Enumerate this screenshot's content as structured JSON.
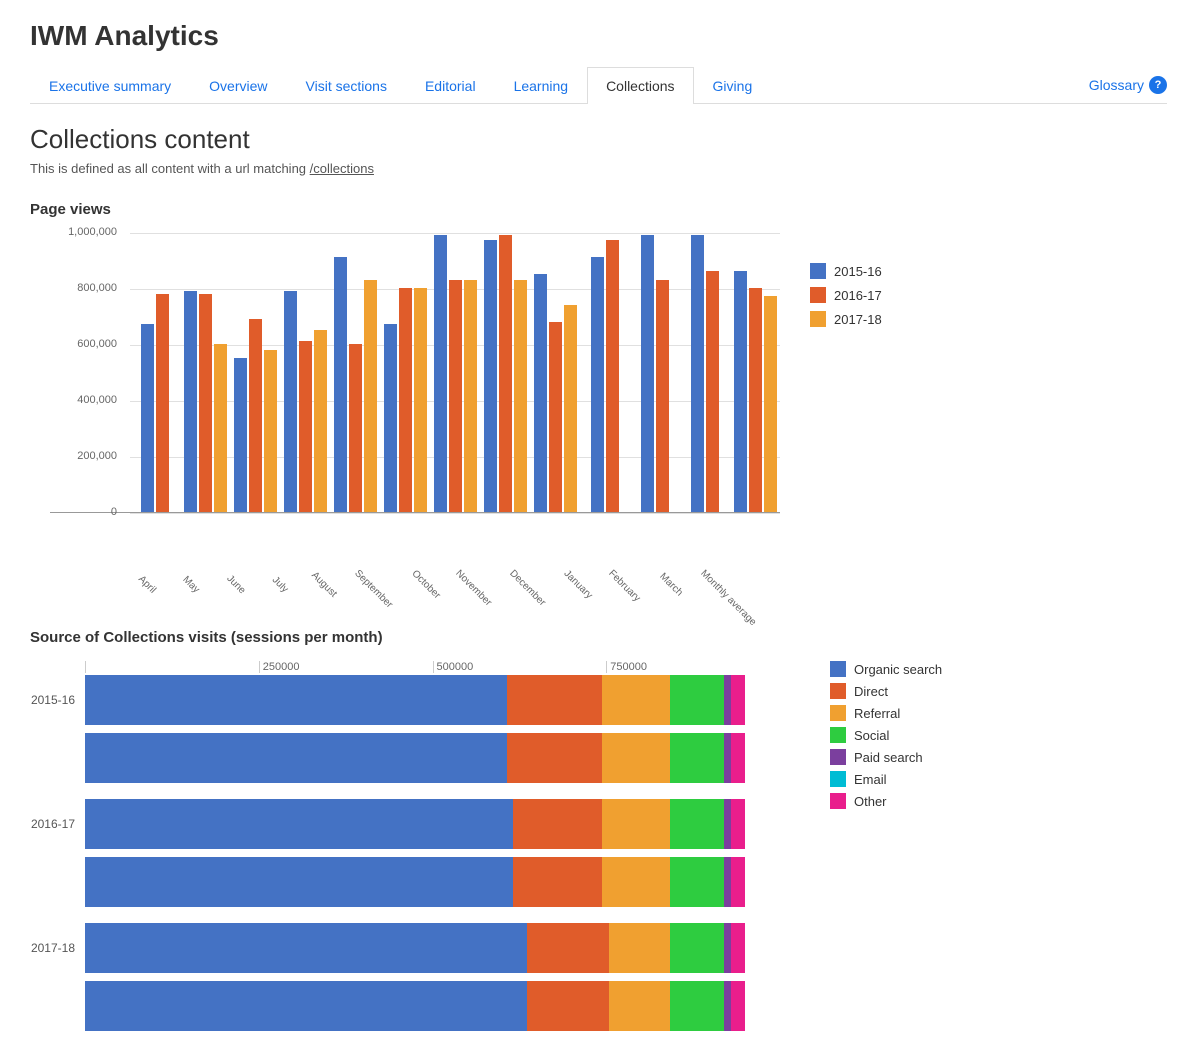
{
  "app": {
    "title": "IWM Analytics"
  },
  "nav": {
    "tabs": [
      {
        "id": "executive-summary",
        "label": "Executive summary",
        "active": false
      },
      {
        "id": "overview",
        "label": "Overview",
        "active": false
      },
      {
        "id": "visit-sections",
        "label": "Visit sections",
        "active": false
      },
      {
        "id": "editorial",
        "label": "Editorial",
        "active": false
      },
      {
        "id": "learning",
        "label": "Learning",
        "active": false
      },
      {
        "id": "collections",
        "label": "Collections",
        "active": true
      },
      {
        "id": "giving",
        "label": "Giving",
        "active": false
      }
    ],
    "glossary_label": "Glossary",
    "help_icon": "?"
  },
  "page": {
    "heading": "Collections content",
    "subtext_prefix": "This is defined as all content with a url matching",
    "subtext_url": "/collections"
  },
  "page_views": {
    "section_title": "Page views",
    "y_labels": [
      "1000000",
      "800000",
      "600000",
      "400000",
      "200000",
      "0"
    ],
    "months": [
      "April",
      "May",
      "June",
      "July",
      "August",
      "September",
      "October",
      "November",
      "December",
      "January",
      "February",
      "March",
      "Monthly average"
    ],
    "legend": [
      {
        "label": "2015-16",
        "color": "#4472c4"
      },
      {
        "label": "2016-17",
        "color": "#e05c2a"
      },
      {
        "label": "2017-18",
        "color": "#f0a030"
      }
    ],
    "bars": [
      {
        "month": "April",
        "b1": 67,
        "b2": 78,
        "b3": 0
      },
      {
        "month": "May",
        "b1": 79,
        "b2": 78,
        "b3": 60
      },
      {
        "month": "June",
        "b1": 55,
        "b2": 69,
        "b3": 58
      },
      {
        "month": "July",
        "b1": 79,
        "b2": 61,
        "b3": 65
      },
      {
        "month": "August",
        "b1": 91,
        "b2": 60,
        "b3": 83
      },
      {
        "month": "September",
        "b1": 67,
        "b2": 80,
        "b3": 80
      },
      {
        "month": "October",
        "b1": 99,
        "b2": 83,
        "b3": 83
      },
      {
        "month": "November",
        "b1": 97,
        "b2": 99,
        "b3": 83
      },
      {
        "month": "December",
        "b1": 85,
        "b2": 68,
        "b3": 74
      },
      {
        "month": "January",
        "b1": 91,
        "b2": 97,
        "b3": 0
      },
      {
        "month": "February",
        "b1": 99,
        "b2": 83,
        "b3": 0
      },
      {
        "month": "March",
        "b1": 99,
        "b2": 86,
        "b3": 0
      },
      {
        "month": "Monthly average",
        "b1": 86,
        "b2": 80,
        "b3": 77
      }
    ]
  },
  "source": {
    "section_title": "Source of Collections visits (sessions per month)",
    "col_labels": [
      "",
      "250000",
      "500000",
      "750000"
    ],
    "rows": [
      {
        "year": "2015-16",
        "segments": [
          {
            "type": "organic",
            "pct": 62
          },
          {
            "type": "direct",
            "pct": 14
          },
          {
            "type": "referral",
            "pct": 10
          },
          {
            "type": "social",
            "pct": 8
          },
          {
            "type": "paid",
            "pct": 1
          },
          {
            "type": "other",
            "pct": 2
          }
        ]
      },
      {
        "year": "2016-17",
        "segments": [
          {
            "type": "organic",
            "pct": 63
          },
          {
            "type": "direct",
            "pct": 13
          },
          {
            "type": "referral",
            "pct": 10
          },
          {
            "type": "social",
            "pct": 8
          },
          {
            "type": "paid",
            "pct": 1
          },
          {
            "type": "other",
            "pct": 2
          }
        ]
      },
      {
        "year": "2017-18",
        "segments": [
          {
            "type": "organic",
            "pct": 65
          },
          {
            "type": "direct",
            "pct": 12
          },
          {
            "type": "referral",
            "pct": 9
          },
          {
            "type": "social",
            "pct": 8
          },
          {
            "type": "paid",
            "pct": 1
          },
          {
            "type": "other",
            "pct": 2
          }
        ]
      }
    ],
    "legend": [
      {
        "label": "Organic search",
        "color": "#4472c4"
      },
      {
        "label": "Direct",
        "color": "#e05c2a"
      },
      {
        "label": "Referral",
        "color": "#f0a030"
      },
      {
        "label": "Social",
        "color": "#2ecc40"
      },
      {
        "label": "Paid search",
        "color": "#7b3f9e"
      },
      {
        "label": "Email",
        "color": "#00bcd4"
      },
      {
        "label": "Other",
        "color": "#e91e8c"
      }
    ]
  }
}
